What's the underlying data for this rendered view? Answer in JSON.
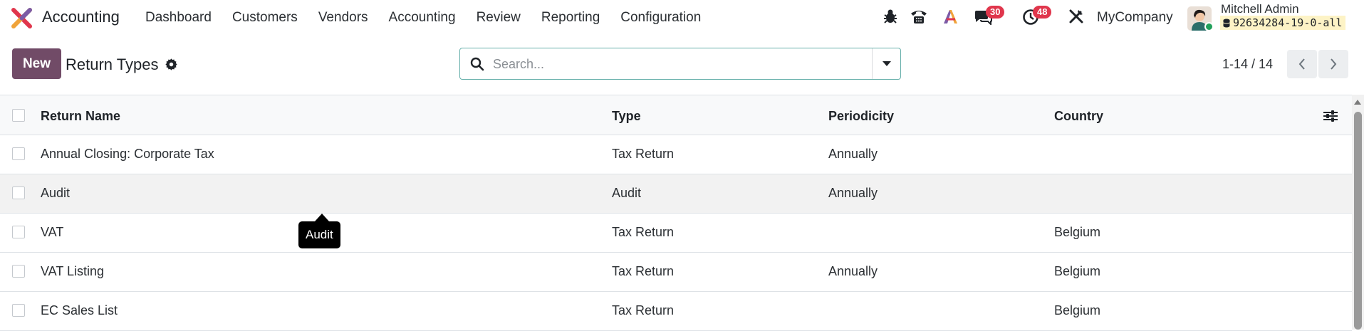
{
  "app": {
    "name": "Accounting",
    "logo_icon": "odoo-app-logo-icon"
  },
  "menu": [
    "Dashboard",
    "Customers",
    "Vendors",
    "Accounting",
    "Review",
    "Reporting",
    "Configuration"
  ],
  "systray": {
    "debug_icon": "bug-icon",
    "phone_icon": "telephone-icon",
    "ai_icon": "ai-assistant-icon",
    "messages_count": "30",
    "activities_count": "48",
    "settings_icon": "tools-icon",
    "company": "MyCompany",
    "user_name": "Mitchell Admin",
    "database": "92634284-19-0-all"
  },
  "control_panel": {
    "new_label": "New",
    "title": "Return Types",
    "search_placeholder": "Search...",
    "pager": "1-14 / 14"
  },
  "list": {
    "columns": [
      "Return Name",
      "Type",
      "Periodicity",
      "Country"
    ],
    "rows": [
      {
        "name": "Annual Closing: Corporate Tax",
        "type": "Tax Return",
        "periodicity": "Annually",
        "country": ""
      },
      {
        "name": "Audit",
        "type": "Audit",
        "periodicity": "Annually",
        "country": ""
      },
      {
        "name": "VAT",
        "type": "Tax Return",
        "periodicity": "",
        "country": "Belgium"
      },
      {
        "name": "VAT Listing",
        "type": "Tax Return",
        "periodicity": "Annually",
        "country": "Belgium"
      },
      {
        "name": "EC Sales List",
        "type": "Tax Return",
        "periodicity": "",
        "country": "Belgium"
      }
    ]
  },
  "tooltip": "Audit",
  "colors": {
    "primary": "#714b67",
    "badge": "#e0364c",
    "accent": "#67b0ab"
  }
}
